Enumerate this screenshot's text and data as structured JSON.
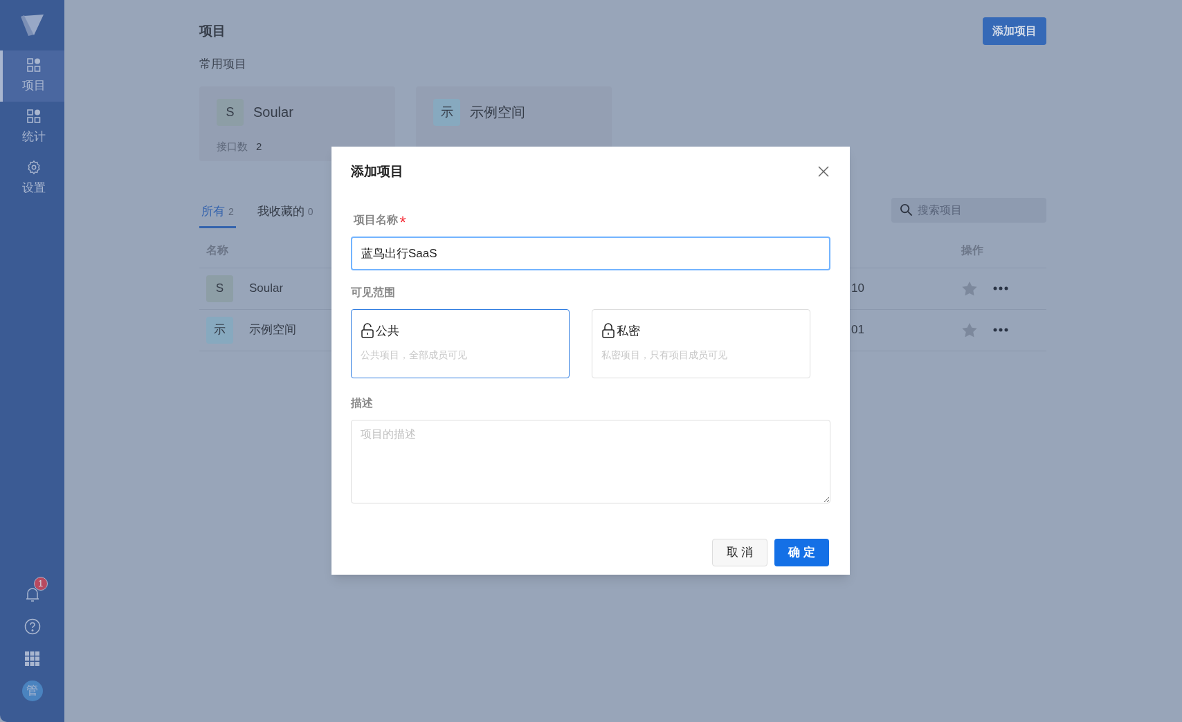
{
  "sidebar": {
    "nav": [
      {
        "label": "项目",
        "selected": true
      },
      {
        "label": "统计",
        "selected": false
      },
      {
        "label": "设置",
        "selected": false
      }
    ],
    "notification_count": "1",
    "avatar": "管"
  },
  "header": {
    "title": "项目",
    "add_button": "添加项目"
  },
  "favorites": {
    "title": "常用项目",
    "cards": [
      {
        "initial": "S",
        "name": "Soular",
        "color": "#8d9ea6",
        "stats": [
          {
            "label": "接口数",
            "value": "2"
          }
        ]
      },
      {
        "initial": "示",
        "name": "示例空间",
        "color": "#87a9bf"
      }
    ]
  },
  "tabs": [
    {
      "label": "所有",
      "count": "2",
      "selected": true
    },
    {
      "label": "我收藏的",
      "count": "0",
      "selected": false
    }
  ],
  "search": {
    "placeholder": "搜索项目"
  },
  "table": {
    "columns": [
      "名称",
      "操作"
    ],
    "rows": [
      {
        "initial": "S",
        "name": "Soular",
        "color": "#8d9ea6",
        "column_3": "10"
      },
      {
        "initial": "示",
        "name": "示例空间",
        "color": "#87a9bf",
        "column_3": "01"
      }
    ]
  },
  "dialog": {
    "title": "添加项目",
    "name_label": "项目名称",
    "required": true,
    "name_value": "蓝鸟出行SaaS",
    "visibility_label": "可见范围",
    "options": [
      {
        "kind": "public",
        "title": "公共",
        "description": "公共项目，全部成员可见",
        "selected": true
      },
      {
        "kind": "private",
        "title": "私密",
        "description": "私密项目，只有项目成员可见",
        "selected": false
      }
    ],
    "description_label": "描述",
    "description_placeholder": "项目的描述",
    "cancel": "取 消",
    "ok": "确 定"
  }
}
